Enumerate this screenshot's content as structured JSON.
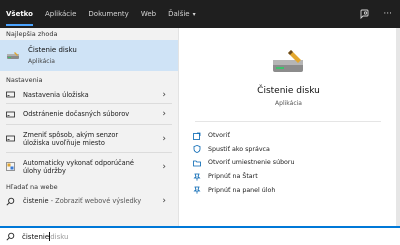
{
  "tabs": [
    {
      "label": "Všetko"
    },
    {
      "label": "Aplikácie"
    },
    {
      "label": "Dokumenty"
    },
    {
      "label": "Web"
    },
    {
      "label": "Ďalšie"
    }
  ],
  "left": {
    "best_match_title": "Najlepšia zhoda",
    "best_match": {
      "name": "Čistenie disku",
      "subtitle": "Aplikácia"
    },
    "settings_title": "Nastavenia",
    "settings": [
      {
        "label": "Nastavenia úložiska"
      },
      {
        "label": "Odstránenie dočasných súborov"
      },
      {
        "label": "Zmeniť spôsob, akým senzor úložiska uvoľňuje miesto"
      },
      {
        "label": "Automaticky vykonať odporúčané úlohy údržby"
      }
    ],
    "web_title": "Hľadať na webe",
    "web_item": {
      "query": "čistenie",
      "suffix": " - Zobraziť webové výsledky"
    }
  },
  "right": {
    "name": "Čistenie disku",
    "subtitle": "Aplikácia",
    "actions": [
      {
        "label": "Otvoriť"
      },
      {
        "label": "Spustiť ako správca"
      },
      {
        "label": "Otvoriť umiestnenie súboru"
      },
      {
        "label": "Pripnúť na Štart"
      },
      {
        "label": "Pripnúť na panel úloh"
      }
    ]
  },
  "search": {
    "typed": "čistenie",
    "hint": "disku"
  },
  "colors": {
    "accent": "#0078d7",
    "selected": "#cfe3f6"
  }
}
